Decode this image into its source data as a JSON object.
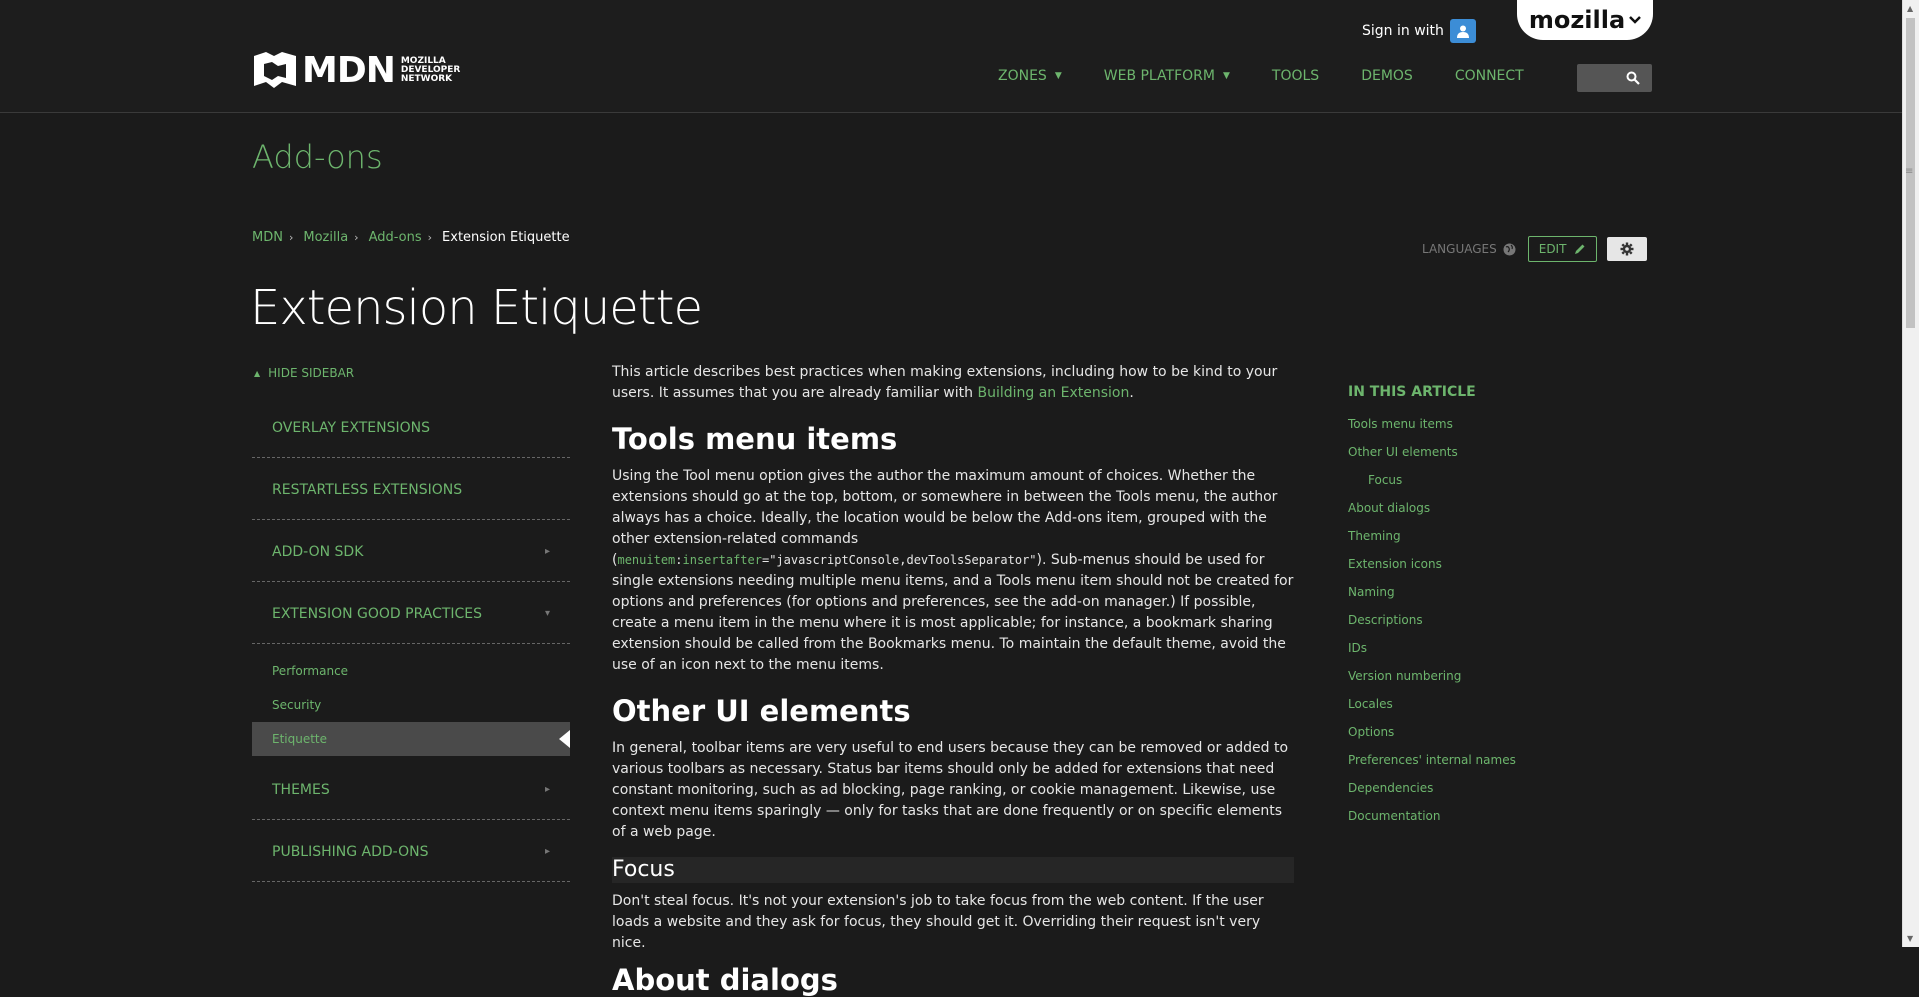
{
  "header": {
    "logo_text": "MDN",
    "logo_subtext": "MOZILLA DEVELOPER NETWORK",
    "signin_label": "Sign in with",
    "mozilla_tab": "mozilla",
    "nav": [
      {
        "label": "ZONES",
        "has_dropdown": true
      },
      {
        "label": "WEB PLATFORM",
        "has_dropdown": true
      },
      {
        "label": "TOOLS",
        "has_dropdown": false
      },
      {
        "label": "DEMOS",
        "has_dropdown": false
      },
      {
        "label": "CONNECT",
        "has_dropdown": false
      }
    ],
    "search_icon": "search-icon"
  },
  "zone_title": "Add-ons",
  "breadcrumbs": [
    "MDN",
    "Mozilla",
    "Add-ons",
    "Extension Etiquette"
  ],
  "page_buttons": {
    "languages": "LANGUAGES",
    "edit": "EDIT"
  },
  "page_title": "Extension Etiquette",
  "sidebar": {
    "hide_label": "HIDE SIDEBAR",
    "items": [
      {
        "label": "OVERLAY EXTENSIONS",
        "arrow": ""
      },
      {
        "label": "RESTARTLESS EXTENSIONS",
        "arrow": ""
      },
      {
        "label": "ADD-ON SDK",
        "arrow": "▸"
      },
      {
        "label": "EXTENSION GOOD PRACTICES",
        "arrow": "▾"
      }
    ],
    "subitems": [
      {
        "label": "Performance"
      },
      {
        "label": "Security"
      },
      {
        "label": "Etiquette"
      }
    ],
    "items_after": [
      {
        "label": "THEMES",
        "arrow": "▸"
      },
      {
        "label": "PUBLISHING ADD-ONS",
        "arrow": "▸"
      }
    ]
  },
  "article": {
    "intro_1": "This article describes best practices when making extensions, including how to be kind to your users. It assumes that you are already familiar with ",
    "intro_link": "Building an Extension",
    "intro_2": ".",
    "h_tools": "Tools menu items",
    "tools_1": "Using the Tool menu option gives the author the maximum amount of choices. Whether the extensions should go at the top, bottom, or somewhere in between the Tools menu, the author always has a choice. Ideally, the location would be below the Add-ons item, grouped with the other extension-related commands (",
    "tools_code_attr1": "menuitem",
    "tools_code_colon": ":",
    "tools_code_attr2": "insertafter",
    "tools_code_value": "=\"javascriptConsole,devToolsSeparator\"",
    "tools_2": "). Sub-menus should be used for single extensions needing multiple menu items, and a Tools menu item should not be created for options and preferences (for options and preferences, see the add-on manager.) If possible, create a menu item in the menu where it is most applicable; for instance, a bookmark sharing extension should be called from the Bookmarks menu. To maintain the default theme, avoid the use of an icon next to the menu items.",
    "h_other": "Other UI elements",
    "other_p": "In general, toolbar items are very useful to end users because they can be removed or added to various toolbars as necessary. Status bar items should only be added for extensions that need constant monitoring, such as ad blocking, page ranking, or cookie management. Likewise, use context menu items sparingly — only for tasks that are done frequently or on specific elements of a web page.",
    "h_focus": "Focus",
    "focus_p": "Don't steal focus. It's not your extension's job to take focus from the web content.  If the user loads a website and they ask for focus, they should get it. Overriding their request isn't very nice.",
    "h_about_cut": "About dialogs"
  },
  "toc": {
    "heading": "IN THIS ARTICLE",
    "items": [
      {
        "label": "Tools menu items",
        "indent": false
      },
      {
        "label": "Other UI elements",
        "indent": false
      },
      {
        "label": "Focus",
        "indent": true
      },
      {
        "label": "About dialogs",
        "indent": false
      },
      {
        "label": "Theming",
        "indent": false
      },
      {
        "label": "Extension icons",
        "indent": false
      },
      {
        "label": "Naming",
        "indent": false
      },
      {
        "label": "Descriptions",
        "indent": false
      },
      {
        "label": "IDs",
        "indent": false
      },
      {
        "label": "Version numbering",
        "indent": false
      },
      {
        "label": "Locales",
        "indent": false
      },
      {
        "label": "Options",
        "indent": false
      },
      {
        "label": "Preferences' internal names",
        "indent": false
      },
      {
        "label": "Dependencies",
        "indent": false
      },
      {
        "label": "Documentation",
        "indent": false
      }
    ]
  },
  "colors": {
    "background": "#1b1b1b",
    "accent": "#6db56d",
    "text": "#e6e6e6"
  }
}
